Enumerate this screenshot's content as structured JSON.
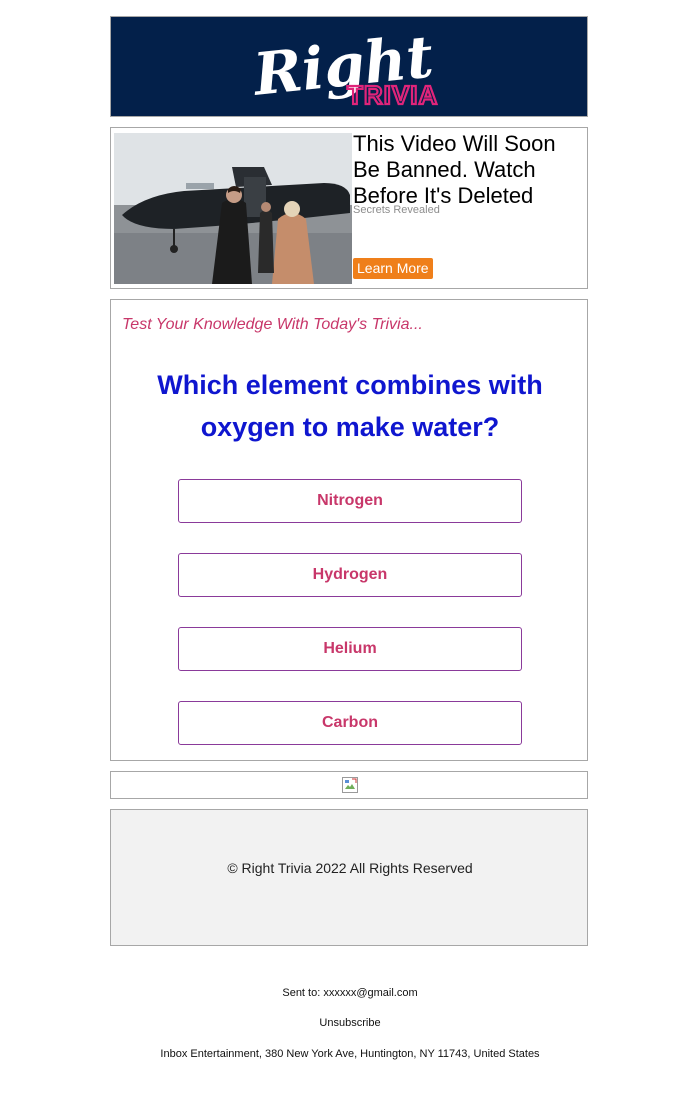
{
  "header": {
    "logo_word": "Right",
    "logo_sub": "TRIVIA",
    "bg_color": "#03204a",
    "sub_color": "#e0247a"
  },
  "ad": {
    "image_icon": "private-jet-photo",
    "title": "This Video Will Soon Be Banned. Watch Before It's Deleted",
    "source": "Secrets Revealed",
    "button_label": "Learn More",
    "button_color": "#ef7f1a"
  },
  "trivia": {
    "intro": "Test Your Knowledge With Today's Trivia...",
    "question": "Which element combines with oxygen to make water?",
    "answers": [
      "Nitrogen",
      "Hydrogen",
      "Helium",
      "Carbon"
    ],
    "question_color": "#0f16cf",
    "accent_color": "#c8376a"
  },
  "image_row": {
    "icon": "broken-image-icon"
  },
  "footer": {
    "copyright": "© Right Trivia 2022 All Rights Reserved"
  },
  "meta": {
    "sent_to_label": "Sent to:",
    "sent_to_email": "xxxxxx@gmail.com",
    "unsubscribe": "Unsubscribe",
    "address": "Inbox Entertainment, 380 New York Ave, Huntington, NY 11743, United States"
  }
}
